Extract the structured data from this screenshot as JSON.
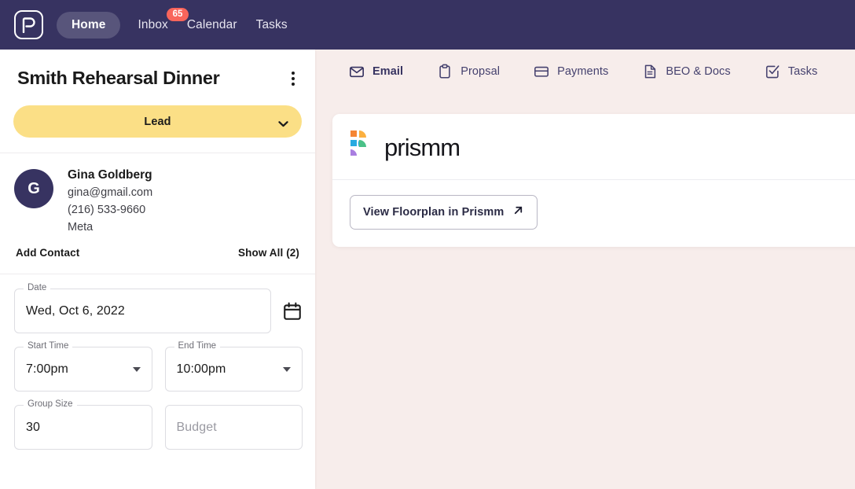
{
  "topnav": {
    "logo_icon": "prospect-p-logo-icon",
    "items": [
      {
        "label": "Home",
        "active": true
      },
      {
        "label": "Inbox",
        "badge": "65"
      },
      {
        "label": "Calendar"
      },
      {
        "label": "Tasks"
      }
    ],
    "background_color": "#373361",
    "badge_color": "#f9655b"
  },
  "sidebar": {
    "title": "Smith Rehearsal Dinner",
    "menu_icon": "kebab-menu-icon",
    "status": {
      "label": "Lead",
      "color": "#fbdf86",
      "chevron_icon": "chevron-down-icon"
    },
    "contact": {
      "avatar_initial": "G",
      "avatar_color": "#373361",
      "name": "Gina Goldberg",
      "email": "gina@gmail.com",
      "phone": "(216) 533-9660",
      "company": "Meta",
      "add_label": "Add Contact",
      "show_all_label": "Show All (2)"
    },
    "fields": {
      "date": {
        "label": "Date",
        "value": "Wed, Oct 6, 2022",
        "calendar_icon": "calendar-icon"
      },
      "start_time": {
        "label": "Start Time",
        "value": "7:00pm"
      },
      "end_time": {
        "label": "End Time",
        "value": "10:00pm"
      },
      "group_size": {
        "label": "Group Size",
        "value": "30"
      },
      "budget": {
        "label": "",
        "placeholder": "Budget",
        "value": ""
      }
    }
  },
  "main": {
    "background_color": "#f7edeb",
    "tabs": [
      {
        "label": "Email",
        "icon": "envelope-icon",
        "active": true
      },
      {
        "label": "Propsal",
        "icon": "clipboard-icon",
        "active": false
      },
      {
        "label": "Payments",
        "icon": "credit-card-icon",
        "active": false
      },
      {
        "label": "BEO & Docs",
        "icon": "document-icon",
        "active": false
      },
      {
        "label": "Tasks",
        "icon": "checkbox-check-icon",
        "active": false
      }
    ],
    "card": {
      "brand_name": "prismm",
      "brand_logo_icon": "prismm-logo-icon",
      "action_label": "View Floorplan in Prismm",
      "action_icon": "arrow-up-right-icon"
    }
  }
}
